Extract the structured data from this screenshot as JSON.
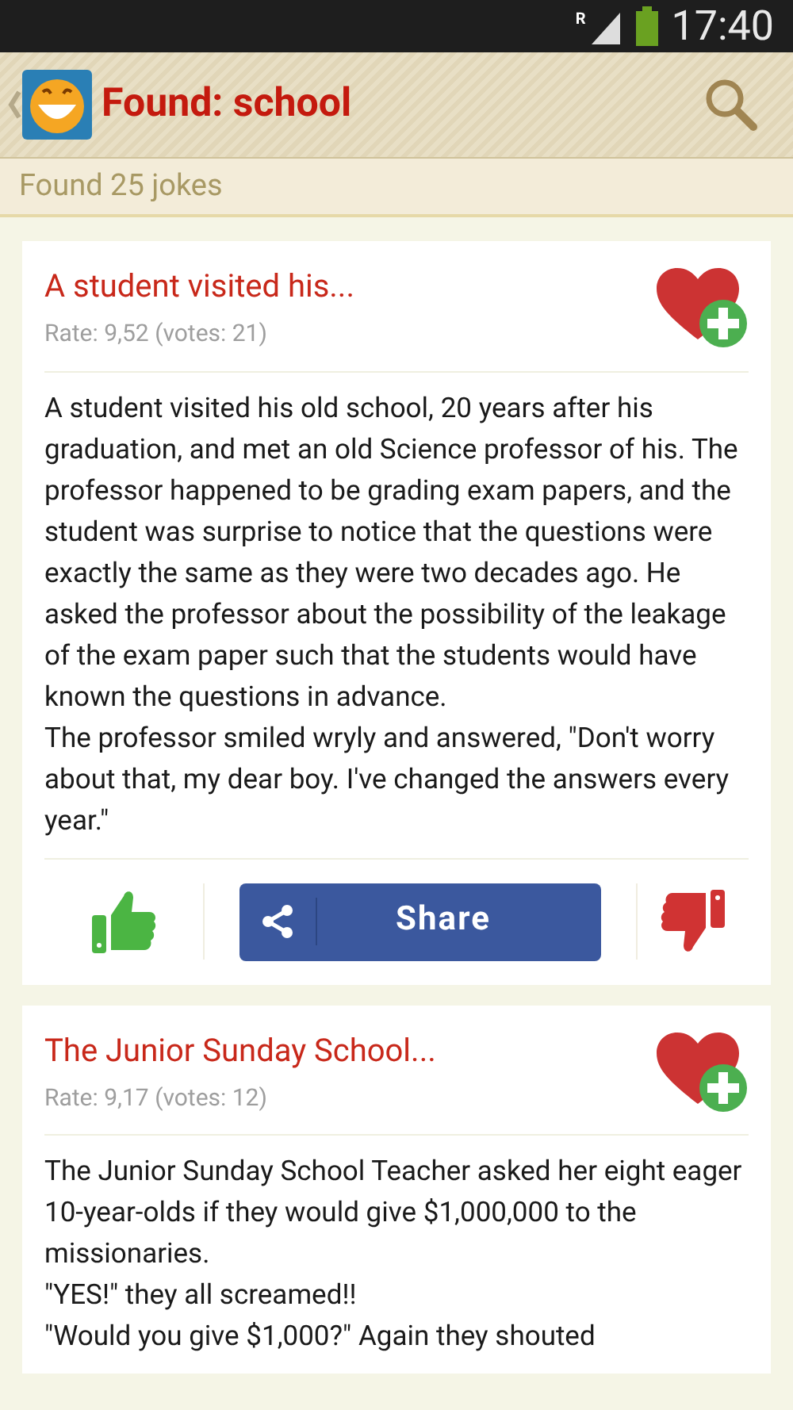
{
  "status_bar": {
    "network_label": "R",
    "time": "17:40"
  },
  "header": {
    "title": "Found: school"
  },
  "subheader": {
    "text": "Found 25 jokes"
  },
  "jokes": [
    {
      "title": "A student visited his...",
      "rating": "Rate: 9,52 (votes: 21)",
      "paragraphs": [
        "A student visited his old school, 20 years after his graduation, and met an old Science professor of his. The professor happened to be grading exam papers, and the student was surprise to notice that the questions were exactly the same as they were two decades ago. He asked the professor about the possibility of the leakage of the exam paper such that the students would have known the questions in advance.",
        "The professor smiled wryly and answered, \"Don't worry about that, my dear boy. I've changed the answers every year.\""
      ],
      "share_label": "Share"
    },
    {
      "title": "The Junior Sunday School...",
      "rating": "Rate: 9,17 (votes: 12)",
      "paragraphs": [
        "The Junior Sunday School Teacher asked her eight eager 10-year-olds if they would give $1,000,000 to the missionaries.",
        "\"YES!\" they all screamed!!",
        "\"Would you give $1,000?\" Again they shouted"
      ]
    }
  ]
}
